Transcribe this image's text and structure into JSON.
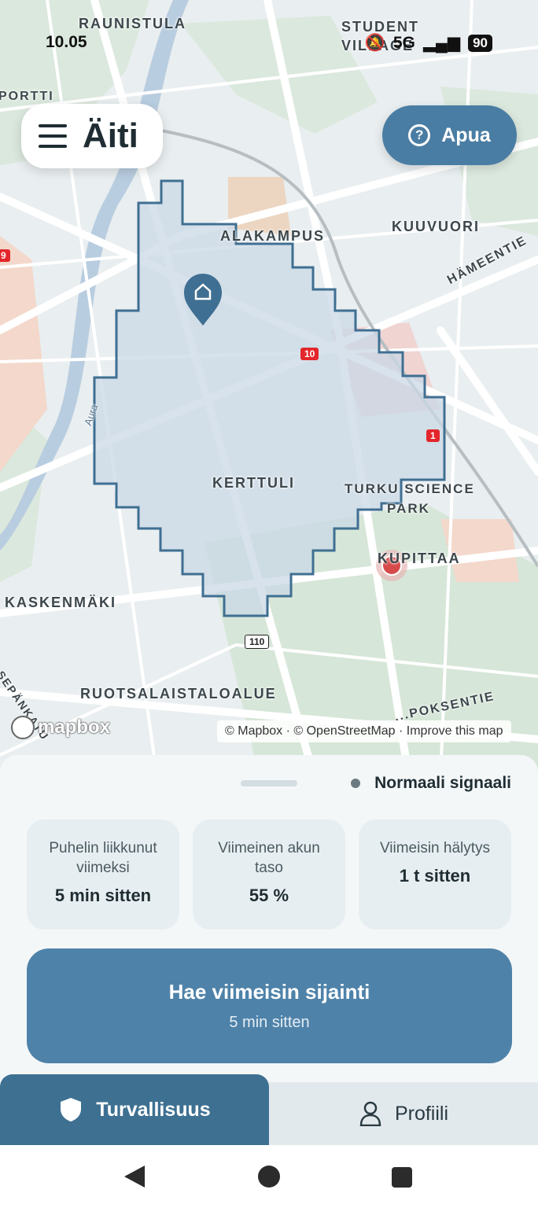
{
  "status_bar": {
    "time": "10.05",
    "network": "5G",
    "battery": "90"
  },
  "header": {
    "title": "Äiti",
    "help_label": "Apua"
  },
  "map": {
    "labels": {
      "raunistula": "RAUNISTULA",
      "student_village": "STUDENT VILLAGE",
      "portti": "PORTTI",
      "alakampus": "ALAKAMPUS",
      "kuuvuori": "KUUVUORI",
      "hameentie": "HÄMEENTIE",
      "aura": "Aura",
      "kerttuli": "KERTTULI",
      "turku_science_park": "TURKU SCIENCE",
      "park": "PARK",
      "kupittaa": "KUPITTAA",
      "kaskenmaki": "KASKENMÄKI",
      "sepankatu": "SEPÄNKATU",
      "ruotsalaistaloalue": "RUOTSALAISTALOALUE",
      "uudenmaantie": "...POKSENTIE"
    },
    "road_numbers": {
      "r10": "10",
      "r1": "1",
      "r110": "110",
      "r9": "9"
    },
    "attribution": "© Mapbox · © OpenStreetMap · Improve this map",
    "logo_text": "mapbox"
  },
  "sheet": {
    "signal_status": "Normaali signaali",
    "cards": [
      {
        "title": "Puhelin liikkunut viimeksi",
        "value": "5 min sitten"
      },
      {
        "title": "Viimeinen akun taso",
        "value": "55 %"
      },
      {
        "title": "Viimeisin hälytys",
        "value": "1 t sitten"
      }
    ],
    "fetch_button": {
      "label": "Hae viimeisin sijainti",
      "sub": "5 min sitten"
    }
  },
  "tabs": {
    "security": "Turvallisuus",
    "profile": "Profiili"
  },
  "colors": {
    "primary": "#4e82a9",
    "active_tab": "#3e7092",
    "zone_fill": "#c9d8e6",
    "zone_stroke": "#3f6f92",
    "marker": "#d64a4a"
  }
}
